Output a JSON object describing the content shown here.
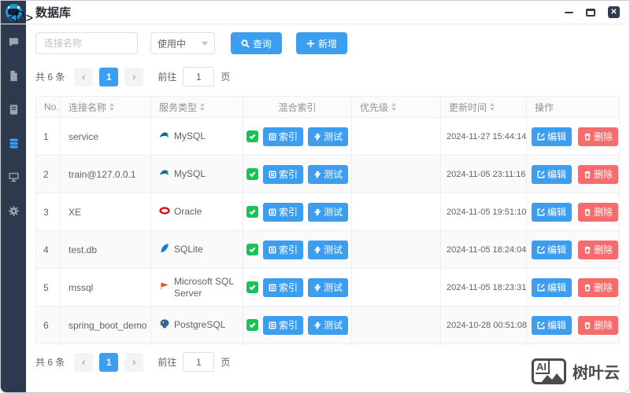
{
  "window": {
    "title": "数据库"
  },
  "sidebar": {
    "items": [
      {
        "icon": "chat-icon",
        "active": false
      },
      {
        "icon": "document-icon",
        "active": false
      },
      {
        "icon": "book-icon",
        "active": false
      },
      {
        "icon": "database-icon",
        "active": true
      },
      {
        "icon": "monitor-icon",
        "active": false
      },
      {
        "icon": "gear-icon",
        "active": false
      }
    ]
  },
  "filters": {
    "name_placeholder": "连接名称",
    "status_value": "使用中",
    "search_label": "查询",
    "add_label": "新增"
  },
  "pagination": {
    "total_text": "共 6 条",
    "current_page": "1",
    "goto_label": "前往",
    "goto_value": "1",
    "unit_label": "页"
  },
  "table": {
    "headers": [
      {
        "label": "No.",
        "sortable": false
      },
      {
        "label": "连接名称",
        "sortable": true
      },
      {
        "label": "服务类型",
        "sortable": true
      },
      {
        "label": "混合索引",
        "sortable": false
      },
      {
        "label": "优先级",
        "sortable": true
      },
      {
        "label": "更新时间",
        "sortable": true
      },
      {
        "label": "操作",
        "sortable": false
      }
    ],
    "rows": [
      {
        "no": "1",
        "name": "service",
        "db": "MySQL",
        "db_icon": "mysql-icon",
        "indexed": true,
        "priority": "",
        "updated": "2024-11-27 15:44:14"
      },
      {
        "no": "2",
        "name": "train@127.0.0.1",
        "db": "MySQL",
        "db_icon": "mysql-icon",
        "indexed": true,
        "priority": "",
        "updated": "2024-11-05 23:11:16"
      },
      {
        "no": "3",
        "name": "XE",
        "db": "Oracle",
        "db_icon": "oracle-icon",
        "indexed": true,
        "priority": "",
        "updated": "2024-11-05 19:51:10"
      },
      {
        "no": "4",
        "name": "test.db",
        "db": "SQLite",
        "db_icon": "sqlite-icon",
        "indexed": true,
        "priority": "",
        "updated": "2024-11-05 18:24:04"
      },
      {
        "no": "5",
        "name": "mssql",
        "db": "Microsoft SQL Server",
        "db_icon": "mssql-icon",
        "indexed": true,
        "priority": "",
        "updated": "2024-11-05 18:23:31"
      },
      {
        "no": "6",
        "name": "spring_boot_demo",
        "db": "PostgreSQL",
        "db_icon": "postgresql-icon",
        "indexed": true,
        "priority": "",
        "updated": "2024-10-28 00:51:08"
      }
    ]
  },
  "row_buttons": {
    "index_label": "索引",
    "test_label": "测试",
    "edit_label": "编辑",
    "delete_label": "删除"
  },
  "watermark": {
    "logo_text": "AI",
    "brand": "树叶云"
  },
  "colors": {
    "primary": "#3d9ef0",
    "danger": "#f56c6c",
    "success": "#17c257",
    "sidebar": "#2d3a4d"
  }
}
